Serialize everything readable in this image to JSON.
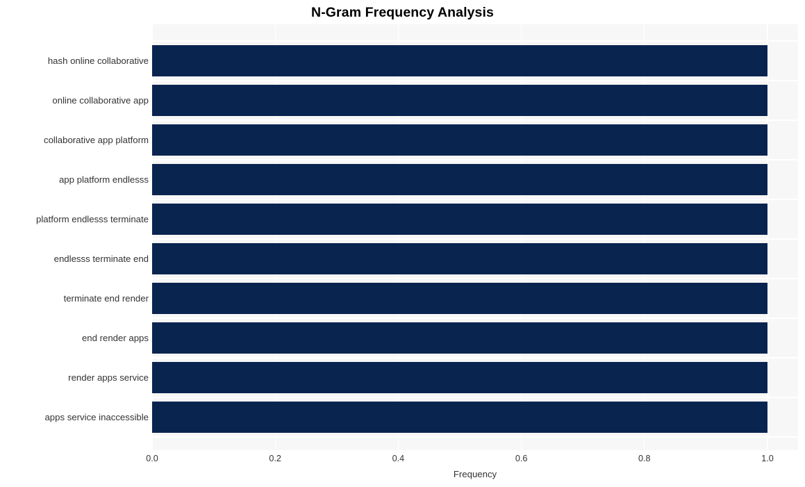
{
  "chart_data": {
    "type": "bar",
    "orientation": "horizontal",
    "title": "N-Gram Frequency Analysis",
    "xlabel": "Frequency",
    "ylabel": "",
    "categories": [
      "hash online collaborative",
      "online collaborative app",
      "collaborative app platform",
      "app platform endlesss",
      "platform endlesss terminate",
      "endlesss terminate end",
      "terminate end render",
      "end render apps",
      "render apps service",
      "apps service inaccessible"
    ],
    "values": [
      1.0,
      1.0,
      1.0,
      1.0,
      1.0,
      1.0,
      1.0,
      1.0,
      1.0,
      1.0
    ],
    "xlim": [
      0.0,
      1.0
    ],
    "xticks": [
      "0.0",
      "0.2",
      "0.4",
      "0.6",
      "0.8",
      "1.0"
    ],
    "xtick_values": [
      0.0,
      0.2,
      0.4,
      0.6,
      0.8,
      1.0
    ],
    "grid": true,
    "legend": false,
    "bar_color": "#0a2450",
    "plot_background": "#f7f7f7",
    "figure_background": "#ffffff",
    "gridline_color": "#ffffff",
    "text_color": "#333333",
    "title_color": "#000000"
  }
}
